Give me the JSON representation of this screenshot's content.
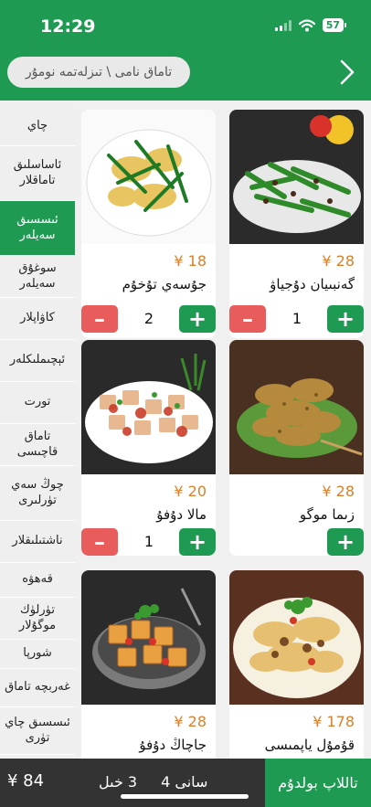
{
  "status": {
    "time": "12:29",
    "battery": "57"
  },
  "search": {
    "placeholder": "تاماق نامى \\ تىزلەتمە نومۇر"
  },
  "categories": [
    "چاي",
    "ئاساسلىق تاماقلار",
    "ئىسسىق سەيلەر",
    "سوغۇق سەيلەر",
    "كاۋاپلار",
    "ئېچىملىكلەر",
    "تورت",
    "تاماق قاچىسى",
    "چوڭ سەي تۈرلىرى",
    "ناشتىلىقلار",
    "قەھۋە",
    "تۈرلۈك موگۇلار",
    "شورپا",
    "غەربچە تاماق",
    "ئىسسىق چاي تۈرى"
  ],
  "items": [
    {
      "price": "¥ 28",
      "name": "گەنبىيان دۇجياۋ",
      "qty": "1"
    },
    {
      "price": "¥ 18",
      "name": "جۇسەي تۇخۇم",
      "qty": "2"
    },
    {
      "price": "¥ 28",
      "name": "زىما موگو",
      "qty": ""
    },
    {
      "price": "¥ 20",
      "name": "مالا دۇفۇ",
      "qty": "1"
    },
    {
      "price": "¥ 178",
      "name": "قۇمۇل ياپمىسى",
      "qty": ""
    },
    {
      "price": "¥ 28",
      "name": "جاچاڭ دۇفۇ",
      "qty": ""
    }
  ],
  "buttons": {
    "minus": "–",
    "plus": "+"
  },
  "bottom": {
    "total": "¥ 84",
    "kinds": "3 خىل",
    "count": "سانى 4",
    "checkout": "تاللاپ بولدۇم"
  },
  "colors": {
    "green": "#1e9a52",
    "red": "#e85c5c",
    "price": "#d9802b",
    "bar": "#333333"
  }
}
